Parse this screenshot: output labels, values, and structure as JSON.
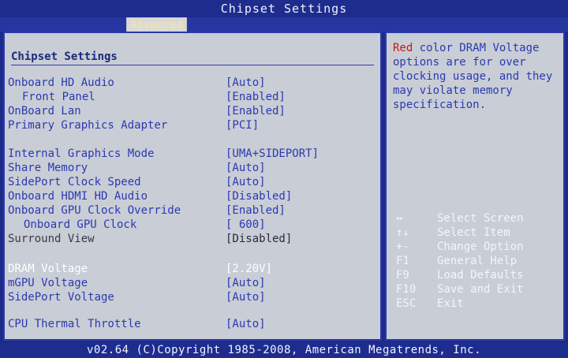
{
  "title": "Chipset Settings",
  "tabs": {
    "active": "Advanced"
  },
  "main": {
    "section_title": "Chipset Settings",
    "rows": [
      {
        "label": "Onboard HD Audio",
        "value": "[Auto]"
      },
      {
        "label": "Front Panel",
        "value": "[Enabled]"
      },
      {
        "label": "OnBoard Lan",
        "value": "[Enabled]"
      },
      {
        "label": "Primary Graphics Adapter",
        "value": "[PCI]"
      },
      {
        "label": "Internal Graphics Mode",
        "value": "[UMA+SIDEPORT]"
      },
      {
        "label": "Share Memory",
        "value": "[Auto]"
      },
      {
        "label": "SidePort Clock Speed",
        "value": "[Auto]"
      },
      {
        "label": "Onboard HDMI HD Audio",
        "value": "[Disabled]"
      },
      {
        "label": "Onboard GPU Clock Override",
        "value": "[Enabled]"
      },
      {
        "label": "Onboard GPU Clock",
        "value": "[ 600]"
      },
      {
        "label": "Surround View",
        "value": "[Disabled]"
      },
      {
        "label": "DRAM Voltage",
        "value": "[2.20V]"
      },
      {
        "label": "mGPU Voltage",
        "value": "[Auto]"
      },
      {
        "label": "SidePort Voltage",
        "value": "[Auto]"
      },
      {
        "label": "CPU Thermal Throttle",
        "value": "[Auto]"
      }
    ]
  },
  "help": {
    "red_word": "Red",
    "rest": " color DRAM Voltage options are for over clocking usage, and they may violate memory specification."
  },
  "keys": [
    {
      "key": "↔",
      "desc": "Select Screen"
    },
    {
      "key": "↑↓",
      "desc": "Select Item"
    },
    {
      "key": "+-",
      "desc": "Change Option"
    },
    {
      "key": "F1",
      "desc": "General Help"
    },
    {
      "key": "F9",
      "desc": "Load Defaults"
    },
    {
      "key": "F10",
      "desc": "Save and Exit"
    },
    {
      "key": "ESC",
      "desc": "Exit"
    }
  ],
  "footer": "v02.64 (C)Copyright 1985-2008, American Megatrends, Inc."
}
